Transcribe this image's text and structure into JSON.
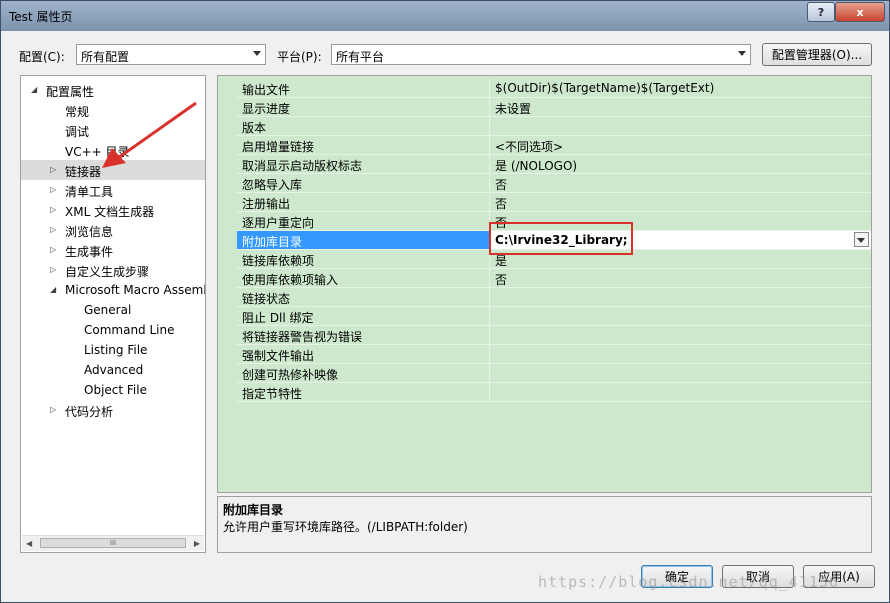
{
  "window": {
    "title": "Test 属性页"
  },
  "toolbar": {
    "config_label": "配置(C):",
    "config_value": "所有配置",
    "platform_label": "平台(P):",
    "platform_value": "所有平台",
    "config_manager_label": "配置管理器(O)..."
  },
  "tree": {
    "items": [
      {
        "label": "配置属性",
        "level": 0,
        "expander": "expanded"
      },
      {
        "label": "常规",
        "level": 1,
        "expander": "none"
      },
      {
        "label": "调试",
        "level": 1,
        "expander": "none"
      },
      {
        "label": "VC++ 目录",
        "level": 1,
        "expander": "none"
      },
      {
        "label": "链接器",
        "level": 1,
        "expander": "collapsed",
        "selected": true
      },
      {
        "label": "清单工具",
        "level": 1,
        "expander": "collapsed"
      },
      {
        "label": "XML 文档生成器",
        "level": 1,
        "expander": "collapsed"
      },
      {
        "label": "浏览信息",
        "level": 1,
        "expander": "collapsed"
      },
      {
        "label": "生成事件",
        "level": 1,
        "expander": "collapsed"
      },
      {
        "label": "自定义生成步骤",
        "level": 1,
        "expander": "collapsed"
      },
      {
        "label": "Microsoft Macro Assembler",
        "level": 1,
        "expander": "expanded"
      },
      {
        "label": "General",
        "level": 2,
        "expander": "none"
      },
      {
        "label": "Command Line",
        "level": 2,
        "expander": "none"
      },
      {
        "label": "Listing File",
        "level": 2,
        "expander": "none"
      },
      {
        "label": "Advanced",
        "level": 2,
        "expander": "none"
      },
      {
        "label": "Object File",
        "level": 2,
        "expander": "none"
      },
      {
        "label": "代码分析",
        "level": 1,
        "expander": "collapsed"
      }
    ],
    "scroll_thumb_glyph": "III"
  },
  "properties": [
    {
      "name": "输出文件",
      "value": "$(OutDir)$(TargetName)$(TargetExt)"
    },
    {
      "name": "显示进度",
      "value": "未设置"
    },
    {
      "name": "版本",
      "value": ""
    },
    {
      "name": "启用增量链接",
      "value": "<不同选项>"
    },
    {
      "name": "取消显示启动版权标志",
      "value": "是 (/NOLOGO)"
    },
    {
      "name": "忽略导入库",
      "value": "否"
    },
    {
      "name": "注册输出",
      "value": "否"
    },
    {
      "name": "逐用户重定向",
      "value": "否"
    },
    {
      "name": "附加库目录",
      "value": "C:\\Irvine32_Library;",
      "selected": true
    },
    {
      "name": "链接库依赖项",
      "value": "是"
    },
    {
      "name": "使用库依赖项输入",
      "value": "否"
    },
    {
      "name": "链接状态",
      "value": ""
    },
    {
      "name": "阻止 Dll 绑定",
      "value": ""
    },
    {
      "name": "将链接器警告视为错误",
      "value": ""
    },
    {
      "name": "强制文件输出",
      "value": ""
    },
    {
      "name": "创建可热修补映像",
      "value": ""
    },
    {
      "name": "指定节特性",
      "value": ""
    }
  ],
  "description": {
    "title": "附加库目录",
    "text": "允许用户重写环境库路径。(/LIBPATH:folder)"
  },
  "buttons": {
    "ok": "确定",
    "cancel": "取消",
    "apply": "应用(A)"
  },
  "titlebar_buttons": {
    "help": "?",
    "close": "x"
  },
  "watermark": "https://blog.csdn.net/qq_41136"
}
